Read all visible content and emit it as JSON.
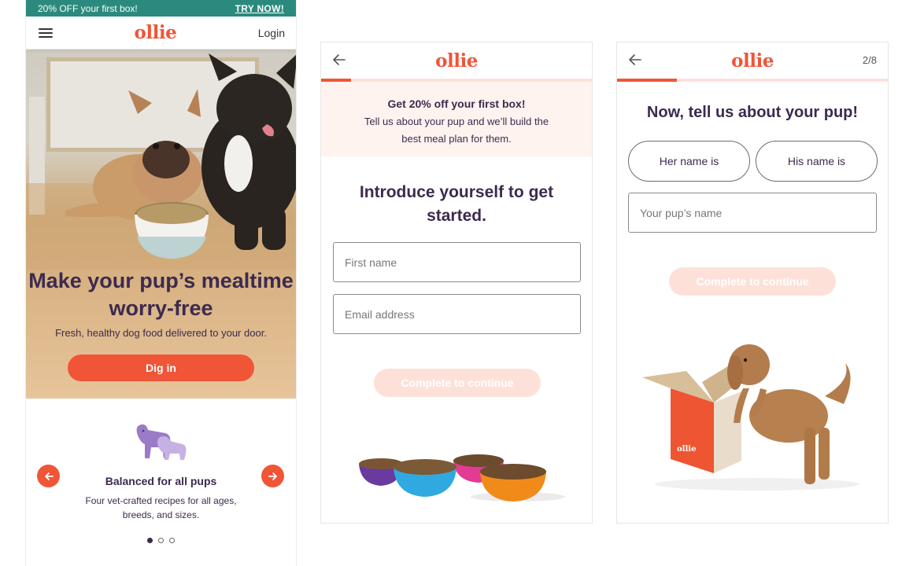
{
  "brand": {
    "logo_text": "ollie",
    "accent": "#f05537",
    "text_color": "#3d2a4e",
    "promo_bg": "#2b8a7d",
    "light_accent": "#fde1d9"
  },
  "home": {
    "promo": {
      "text": "20% OFF your first box!",
      "cta": "TRY NOW!"
    },
    "nav": {
      "menu_icon": "hamburger-menu-icon",
      "login": "Login"
    },
    "hero": {
      "title": "Make your pup’s mealtime worry-free",
      "subtitle": "Fresh, healthy dog food delivered to your door.",
      "cta": "Dig in"
    },
    "feature": {
      "icon": "two-dogs-icon",
      "title": "Balanced for all pups",
      "text": "Four vet-crafted recipes for all ages, breeds, and sizes.",
      "prev_icon": "arrow-left-icon",
      "next_icon": "arrow-right-icon",
      "active_slide": 1,
      "slide_count": 3
    }
  },
  "signup": {
    "back_icon": "arrow-left-icon",
    "progress": 0.11,
    "offer": {
      "title": "Get 20% off your first box!",
      "text": "Tell us about your pup and we’ll build the best meal plan for them."
    },
    "heading": "Introduce yourself to get started.",
    "first_name_placeholder": "First name",
    "email_placeholder": "Email address",
    "continue": "Complete to continue"
  },
  "pup": {
    "back_icon": "arrow-left-icon",
    "step": "2/8",
    "progress": 0.22,
    "heading": "Now, tell us about your pup!",
    "options": [
      "Her name is",
      "His name is"
    ],
    "name_placeholder": "Your pup’s name",
    "continue": "Complete to continue",
    "box_label": "ollie"
  }
}
